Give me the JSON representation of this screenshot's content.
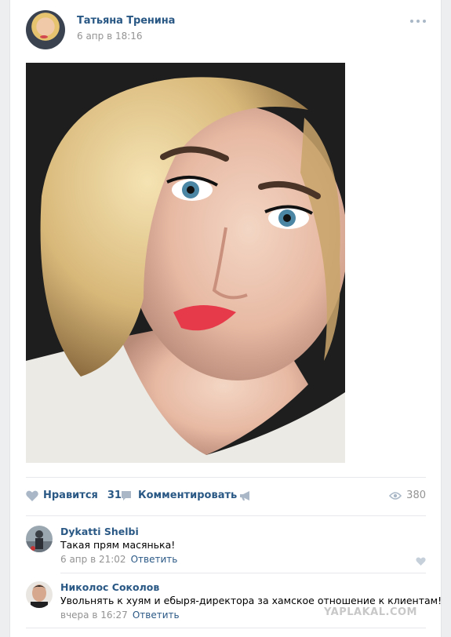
{
  "post": {
    "author": "Татьяна Тренина",
    "date": "6 апр в 18:16",
    "photo_icon": "portrait-photo"
  },
  "actions": {
    "like_label": "Нравится",
    "like_count": "31",
    "comment_label": "Комментировать",
    "views": "380"
  },
  "comments": [
    {
      "author": "Dykatti Shelbi",
      "text": "Такая прям масянька!",
      "date": "6 апр в 21:02",
      "reply_label": "Ответить"
    },
    {
      "author": "Николос Соколов",
      "text": "Увольнять к хуям и ебыря-директора за хамское отношение к клиентам!",
      "date": "вчера в 16:27",
      "reply_label": "Ответить"
    }
  ],
  "watermark": "YAPLAKAL.COM",
  "colors": {
    "link": "#2a5885",
    "muted": "#939393",
    "background": "#edeef0",
    "icon": "#a9b7c6"
  }
}
